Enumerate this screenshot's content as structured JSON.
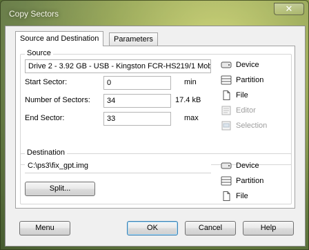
{
  "window": {
    "title": "Copy Sectors",
    "close_symbol": "✕"
  },
  "tabs": [
    {
      "label": "Source and Destination",
      "active": true
    },
    {
      "label": "Parameters",
      "active": false
    }
  ],
  "source": {
    "label": "Source",
    "drive": "Drive 2 - 3.92 GB - USB - Kingston FCR-HS219/1 Mob",
    "start_sector": {
      "label": "Start Sector:",
      "value": "0",
      "unit": "min"
    },
    "number_of_sectors": {
      "label": "Number of Sectors:",
      "value": "34",
      "unit": "17.4 kB"
    },
    "end_sector": {
      "label": "End Sector:",
      "value": "33",
      "unit": "max"
    },
    "options": [
      {
        "label": "Device",
        "icon": "drive-icon",
        "enabled": true
      },
      {
        "label": "Partition",
        "icon": "partition-icon",
        "enabled": true
      },
      {
        "label": "File",
        "icon": "file-icon",
        "enabled": true
      },
      {
        "label": "Editor",
        "icon": "editor-icon",
        "enabled": false
      },
      {
        "label": "Selection",
        "icon": "selection-icon",
        "enabled": false
      }
    ]
  },
  "destination": {
    "label": "Destination",
    "path": "C:\\ps3\\fix_gpt.img",
    "split_label": "Split...",
    "options": [
      {
        "label": "Device",
        "icon": "drive-icon"
      },
      {
        "label": "Partition",
        "icon": "partition-icon"
      },
      {
        "label": "File",
        "icon": "file-icon"
      }
    ]
  },
  "buttons": {
    "menu": "Menu",
    "ok": "OK",
    "cancel": "Cancel",
    "help": "Help"
  },
  "colors": {
    "disabled_text": "#9d9d9d",
    "default_button_border": "#3c7fb1"
  }
}
